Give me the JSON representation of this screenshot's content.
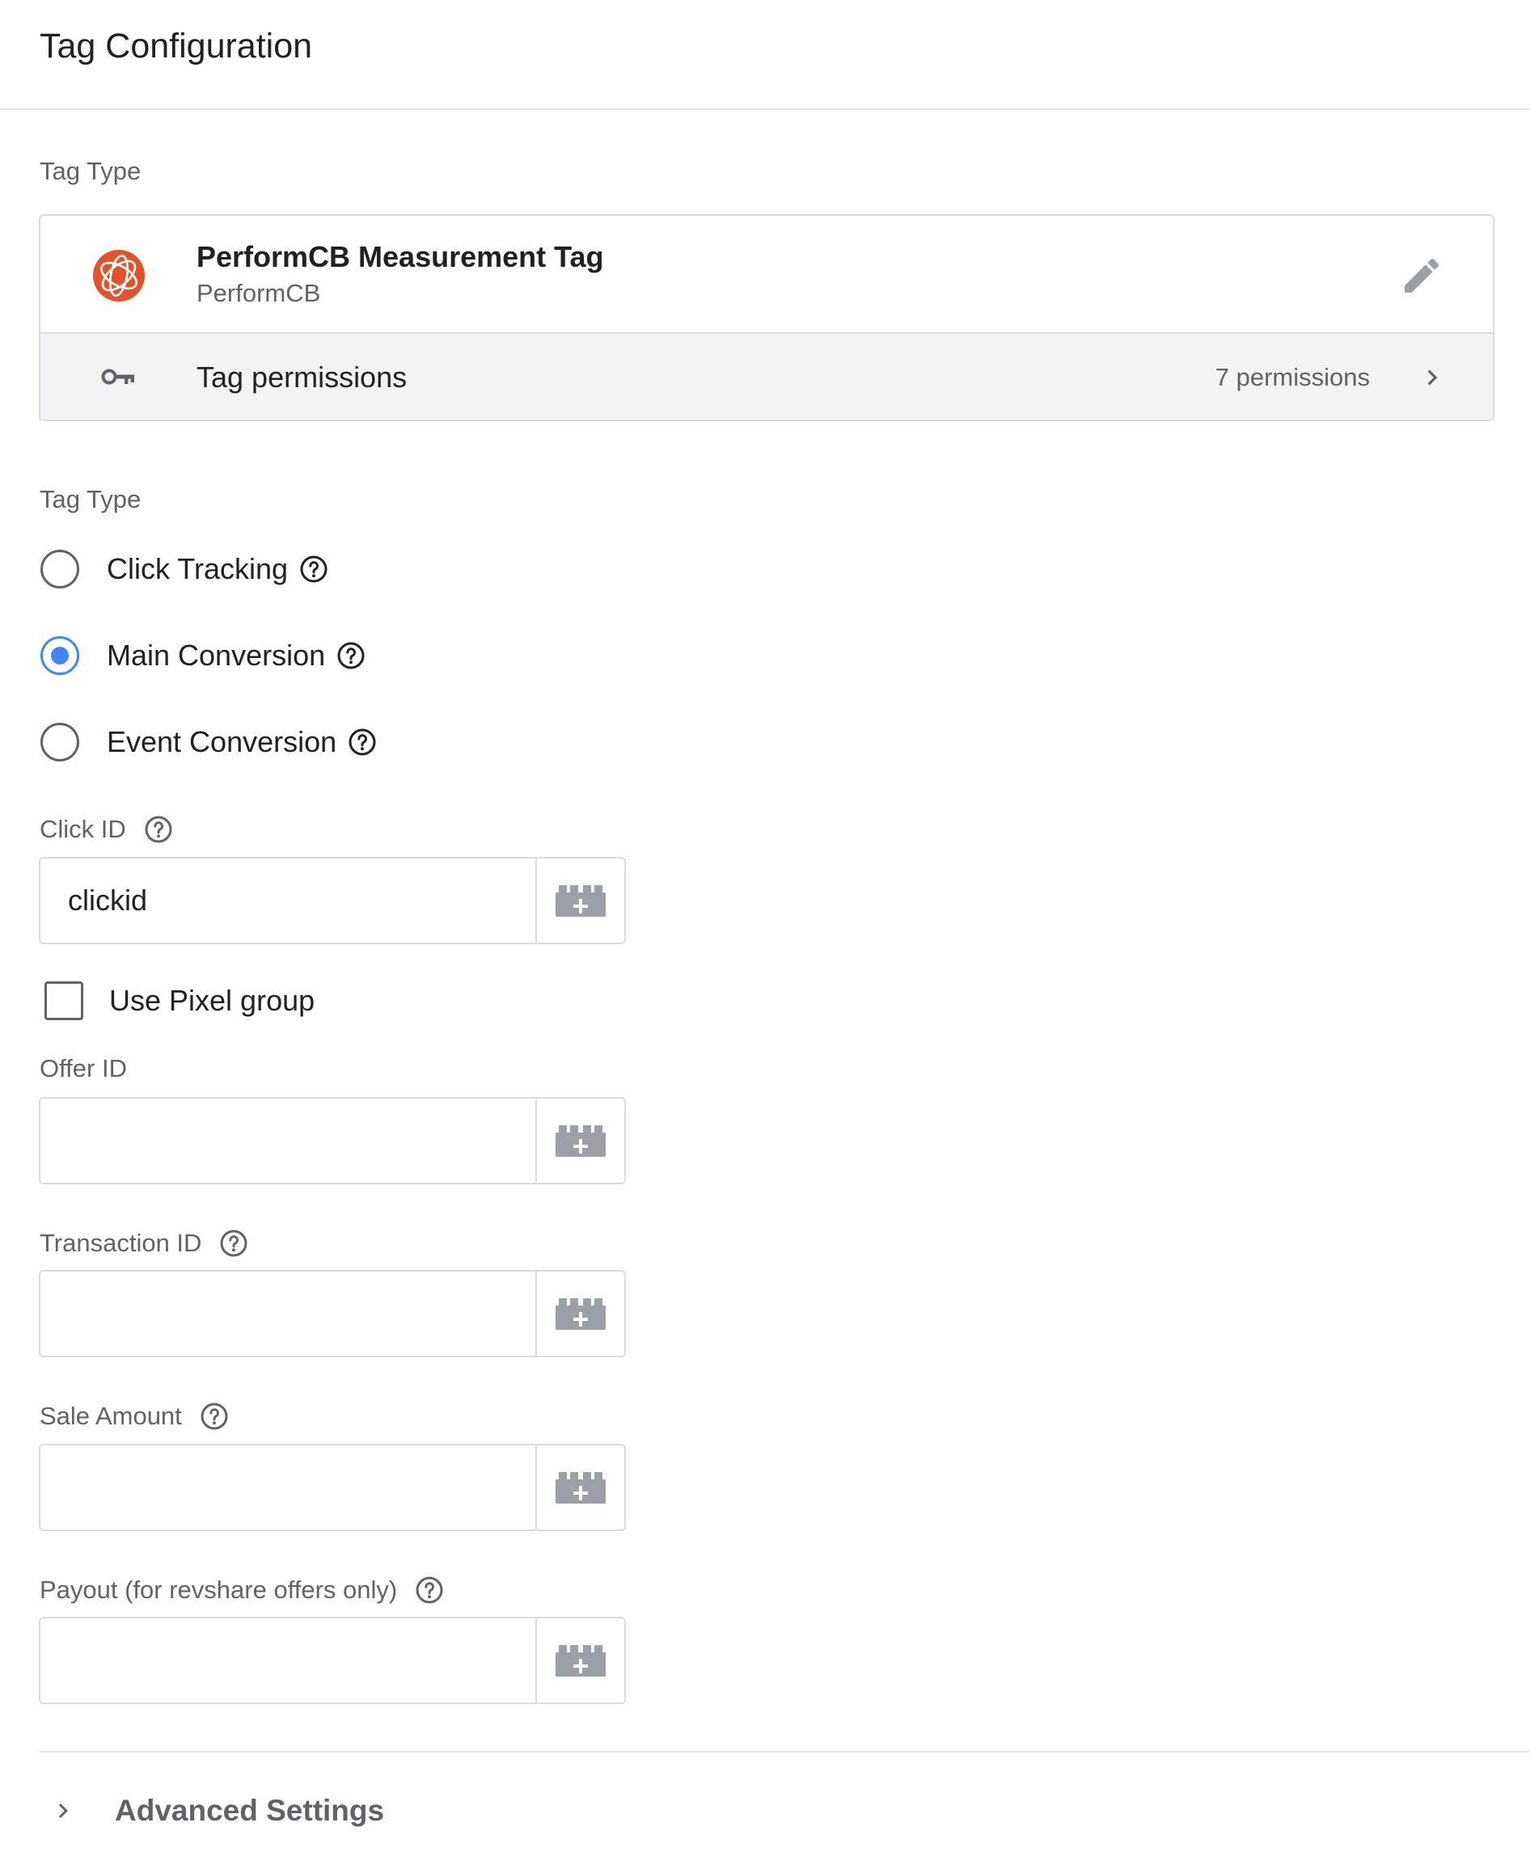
{
  "header": {
    "title": "Tag Configuration"
  },
  "tag_type_section": {
    "label": "Tag Type"
  },
  "tag_type_card": {
    "name": "PerformCB Measurement Tag",
    "vendor": "PerformCB",
    "permissions_label": "Tag permissions",
    "permissions_count": "7 permissions",
    "logo_color": "#e2532d"
  },
  "tag_type_options": {
    "label": "Tag Type",
    "options": [
      {
        "label": "Click Tracking",
        "checked": false
      },
      {
        "label": "Main Conversion",
        "checked": true
      },
      {
        "label": "Event Conversion",
        "checked": false
      }
    ]
  },
  "fields": {
    "click_id": {
      "label": "Click ID",
      "value": "clickid"
    },
    "use_pixel_group": {
      "label": "Use Pixel group",
      "checked": false
    },
    "offer_id": {
      "label": "Offer ID",
      "value": ""
    },
    "transaction_id": {
      "label": "Transaction ID",
      "value": ""
    },
    "sale_amount": {
      "label": "Sale Amount",
      "value": ""
    },
    "payout": {
      "label": "Payout (for revshare offers only)",
      "value": ""
    }
  },
  "advanced": {
    "label": "Advanced Settings"
  },
  "colors": {
    "accent": "#4285f4",
    "border": "#dadce0",
    "muted_text": "#5f6368",
    "icon_grey": "#9aa0a6"
  }
}
